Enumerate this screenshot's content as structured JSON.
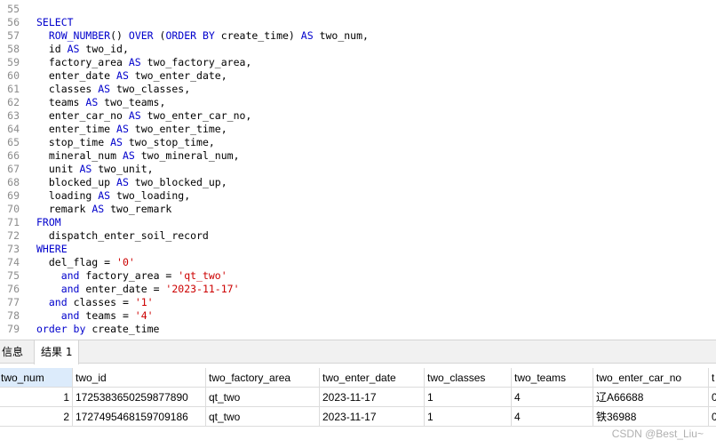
{
  "editor": {
    "lines": [
      {
        "n": "55",
        "parts": []
      },
      {
        "n": "56",
        "parts": [
          {
            "t": "SELECT",
            "c": "kw"
          }
        ]
      },
      {
        "n": "57",
        "parts": [
          {
            "t": "  ",
            "c": ""
          },
          {
            "t": "ROW_NUMBER",
            "c": "fn"
          },
          {
            "t": "() ",
            "c": ""
          },
          {
            "t": "OVER",
            "c": "kw"
          },
          {
            "t": " (",
            "c": ""
          },
          {
            "t": "ORDER BY",
            "c": "kw"
          },
          {
            "t": " create_time) ",
            "c": ""
          },
          {
            "t": "AS",
            "c": "kw"
          },
          {
            "t": " two_num,",
            "c": ""
          }
        ]
      },
      {
        "n": "58",
        "parts": [
          {
            "t": "  id ",
            "c": ""
          },
          {
            "t": "AS",
            "c": "kw"
          },
          {
            "t": " two_id,",
            "c": ""
          }
        ]
      },
      {
        "n": "59",
        "parts": [
          {
            "t": "  factory_area ",
            "c": ""
          },
          {
            "t": "AS",
            "c": "kw"
          },
          {
            "t": " two_factory_area,",
            "c": ""
          }
        ]
      },
      {
        "n": "60",
        "parts": [
          {
            "t": "  enter_date ",
            "c": ""
          },
          {
            "t": "AS",
            "c": "kw"
          },
          {
            "t": " two_enter_date,",
            "c": ""
          }
        ]
      },
      {
        "n": "61",
        "parts": [
          {
            "t": "  classes ",
            "c": ""
          },
          {
            "t": "AS",
            "c": "kw"
          },
          {
            "t": " two_classes,",
            "c": ""
          }
        ]
      },
      {
        "n": "62",
        "parts": [
          {
            "t": "  teams ",
            "c": ""
          },
          {
            "t": "AS",
            "c": "kw"
          },
          {
            "t": " two_teams,",
            "c": ""
          }
        ]
      },
      {
        "n": "63",
        "parts": [
          {
            "t": "  enter_car_no ",
            "c": ""
          },
          {
            "t": "AS",
            "c": "kw"
          },
          {
            "t": " two_enter_car_no,",
            "c": ""
          }
        ]
      },
      {
        "n": "64",
        "parts": [
          {
            "t": "  enter_time ",
            "c": ""
          },
          {
            "t": "AS",
            "c": "kw"
          },
          {
            "t": " two_enter_time,",
            "c": ""
          }
        ]
      },
      {
        "n": "65",
        "parts": [
          {
            "t": "  stop_time ",
            "c": ""
          },
          {
            "t": "AS",
            "c": "kw"
          },
          {
            "t": " two_stop_time,",
            "c": ""
          }
        ]
      },
      {
        "n": "66",
        "parts": [
          {
            "t": "  mineral_num ",
            "c": ""
          },
          {
            "t": "AS",
            "c": "kw"
          },
          {
            "t": " two_mineral_num,",
            "c": ""
          }
        ]
      },
      {
        "n": "67",
        "parts": [
          {
            "t": "  unit ",
            "c": ""
          },
          {
            "t": "AS",
            "c": "kw"
          },
          {
            "t": " two_unit,",
            "c": ""
          }
        ]
      },
      {
        "n": "68",
        "parts": [
          {
            "t": "  blocked_up ",
            "c": ""
          },
          {
            "t": "AS",
            "c": "kw"
          },
          {
            "t": " two_blocked_up,",
            "c": ""
          }
        ]
      },
      {
        "n": "69",
        "parts": [
          {
            "t": "  loading ",
            "c": ""
          },
          {
            "t": "AS",
            "c": "kw"
          },
          {
            "t": " two_loading,",
            "c": ""
          }
        ]
      },
      {
        "n": "70",
        "parts": [
          {
            "t": "  remark ",
            "c": ""
          },
          {
            "t": "AS",
            "c": "kw"
          },
          {
            "t": " two_remark",
            "c": ""
          }
        ]
      },
      {
        "n": "71",
        "parts": [
          {
            "t": "FROM",
            "c": "kw"
          }
        ]
      },
      {
        "n": "72",
        "parts": [
          {
            "t": "  dispatch_enter_soil_record",
            "c": ""
          }
        ]
      },
      {
        "n": "73",
        "parts": [
          {
            "t": "WHERE",
            "c": "kw"
          }
        ]
      },
      {
        "n": "74",
        "parts": [
          {
            "t": "  del_flag = ",
            "c": ""
          },
          {
            "t": "'0'",
            "c": "str"
          }
        ]
      },
      {
        "n": "75",
        "parts": [
          {
            "t": "    ",
            "c": ""
          },
          {
            "t": "and",
            "c": "kw"
          },
          {
            "t": " factory_area = ",
            "c": ""
          },
          {
            "t": "'qt_two'",
            "c": "str"
          }
        ]
      },
      {
        "n": "76",
        "parts": [
          {
            "t": "    ",
            "c": ""
          },
          {
            "t": "and",
            "c": "kw"
          },
          {
            "t": " enter_date = ",
            "c": ""
          },
          {
            "t": "'2023-11-17'",
            "c": "str"
          }
        ]
      },
      {
        "n": "77",
        "parts": [
          {
            "t": "  ",
            "c": ""
          },
          {
            "t": "and",
            "c": "kw"
          },
          {
            "t": " classes = ",
            "c": ""
          },
          {
            "t": "'1'",
            "c": "str"
          }
        ]
      },
      {
        "n": "78",
        "parts": [
          {
            "t": "    ",
            "c": ""
          },
          {
            "t": "and",
            "c": "kw"
          },
          {
            "t": " teams = ",
            "c": ""
          },
          {
            "t": "'4'",
            "c": "str"
          }
        ]
      },
      {
        "n": "79",
        "parts": [
          {
            "t": "order by",
            "c": "kw"
          },
          {
            "t": " create_time",
            "c": ""
          }
        ]
      }
    ]
  },
  "tabs": {
    "info_label": "信息",
    "result_label": "结果 1"
  },
  "grid": {
    "columns": [
      "two_num",
      "two_id",
      "two_factory_area",
      "two_enter_date",
      "two_classes",
      "two_teams",
      "two_enter_car_no",
      "t"
    ],
    "rows": [
      [
        "1",
        "1725383650259877890",
        "qt_two",
        "2023-11-17",
        "1",
        "4",
        "辽A66688",
        "0"
      ],
      [
        "2",
        "1727495468159709186",
        "qt_two",
        "2023-11-17",
        "1",
        "4",
        "铁36988",
        "0"
      ]
    ]
  },
  "watermark": "CSDN @Best_Liu~"
}
